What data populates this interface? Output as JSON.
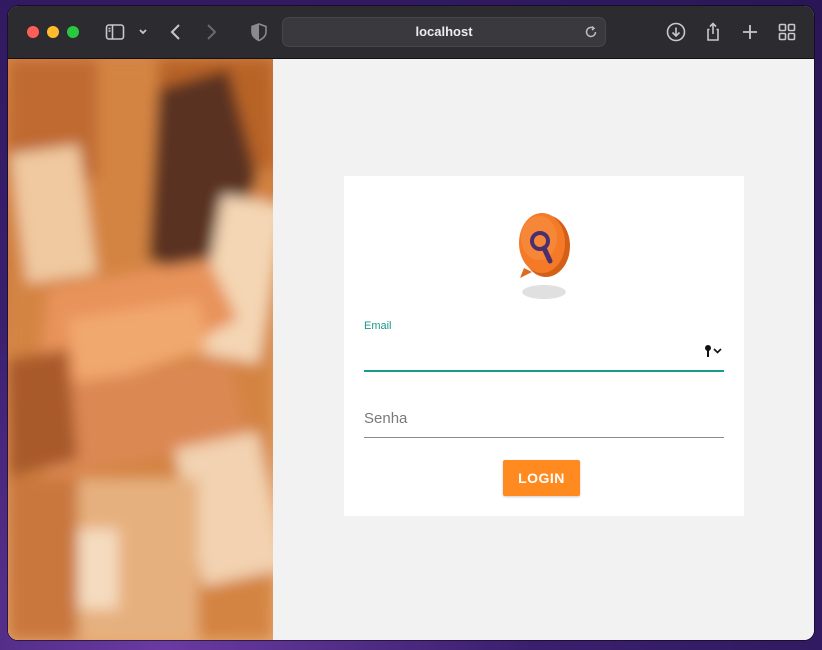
{
  "browser": {
    "url": "localhost",
    "icons": {
      "sidebar": "sidebar-icon",
      "chevron": "chevron-down-icon",
      "back": "back-arrow-icon",
      "forward": "forward-arrow-icon",
      "privacy": "shield-icon",
      "reload": "reload-icon",
      "download": "download-icon",
      "share": "share-icon",
      "new_tab": "plus-icon",
      "tabs_overview": "grid-icon"
    }
  },
  "login": {
    "email_label": "Email",
    "email_value": "",
    "password_placeholder": "Senha",
    "password_value": "",
    "login_label": "LOGIN"
  },
  "colors": {
    "accent": "#ff8a1f",
    "focus": "#1a9a8a",
    "logo_pin": "#f47a28",
    "logo_lens": "#4a2f6e"
  }
}
